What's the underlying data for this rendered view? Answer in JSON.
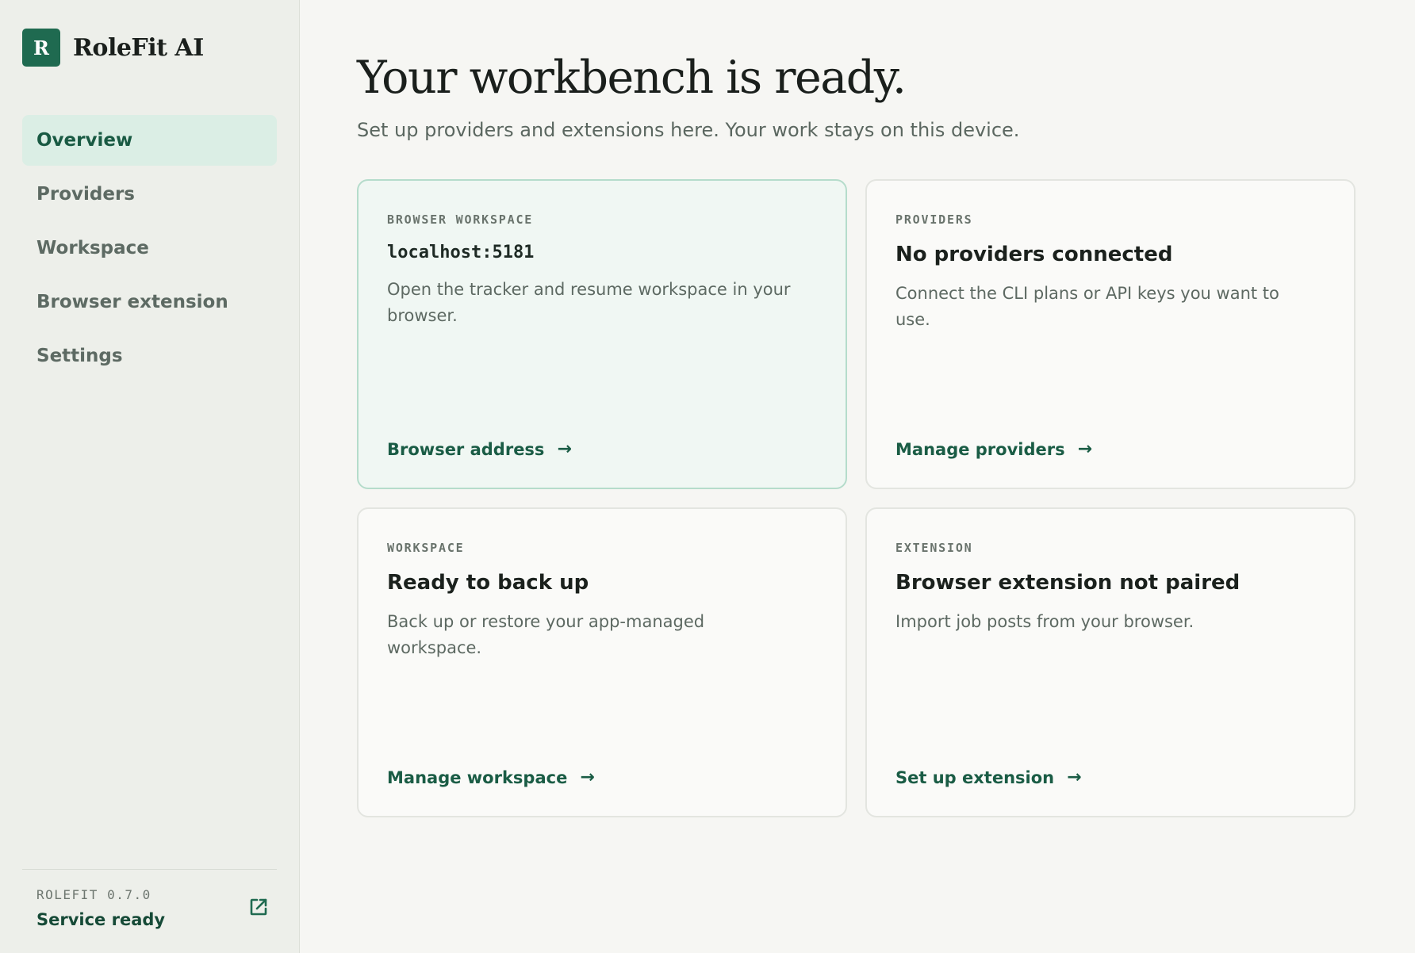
{
  "brand": {
    "logo_letter": "R",
    "name": "RoleFit AI"
  },
  "nav": [
    {
      "label": "Overview",
      "active": true
    },
    {
      "label": "Providers",
      "active": false
    },
    {
      "label": "Workspace",
      "active": false
    },
    {
      "label": "Browser extension",
      "active": false
    },
    {
      "label": "Settings",
      "active": false
    }
  ],
  "footer": {
    "version": "ROLEFIT 0.7.0",
    "status": "Service ready",
    "icon": "external-link-icon"
  },
  "main": {
    "title": "Your workbench is ready.",
    "subtitle": "Set up providers and extensions here. Your work stays on this device."
  },
  "cards": [
    {
      "eyebrow": "BROWSER WORKSPACE",
      "title": "localhost:5181",
      "description": "Open the tracker and resume workspace in your browser.",
      "link": "Browser address",
      "arrow": "→"
    },
    {
      "eyebrow": "PROVIDERS",
      "title": "No providers connected",
      "description": "Connect the CLI plans or API keys you want to use.",
      "link": "Manage providers",
      "arrow": "→"
    },
    {
      "eyebrow": "WORKSPACE",
      "title": "Ready to back up",
      "description": "Back up or restore your app-managed workspace.",
      "link": "Manage workspace",
      "arrow": "→"
    },
    {
      "eyebrow": "EXTENSION",
      "title": "Browser extension not paired",
      "description": "Import job posts from your browser.",
      "link": "Set up extension",
      "arrow": "→"
    }
  ],
  "colors": {
    "accent": "#1f6a50",
    "active_nav_bg": "#dbeee5",
    "highlight_card_bg": "#f0f7f3",
    "highlight_card_border": "#b5dccb"
  }
}
